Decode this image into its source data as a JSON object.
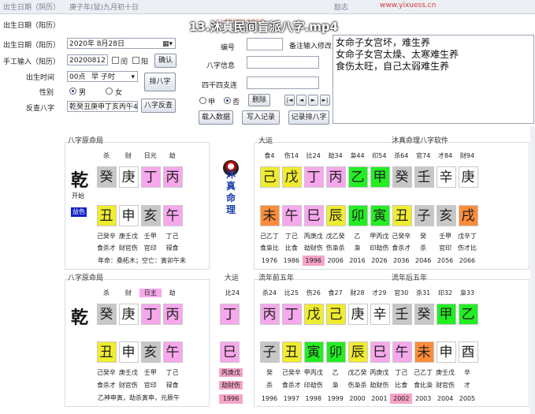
{
  "video_title": "13.沐真民间盲派八字.mp4",
  "topbar": {
    "left_blurred": "出生日期（阴历）",
    "left_value_blurred": "庚子年(鼠)九月初十日",
    "mid_label": "励志",
    "watermark": "www.yixuess.cn",
    "phone_watermark": "1436044440"
  },
  "form": {
    "solar_label": "出生日期（阳历）",
    "solar_value": "2020年 8月28日",
    "manual_label": "手工输入（阳历）",
    "manual_value": "20200812",
    "leap_label": "闰",
    "yang_label": "阳",
    "confirm_btn": "确认",
    "time_label": "出生时间",
    "time_hour": "00点",
    "time_shichen": "早 子时",
    "paipan_btn": "排八字",
    "gender_label": "性别",
    "male": "男",
    "female": "女",
    "reverse_label": "反查八字",
    "reverse_value": "乾癸丑庚申丁亥丙午4",
    "reverse_btn": "八字反查",
    "bianhao_label": "编号",
    "beizhu_label": "备注输入修改",
    "bazi_info_label": "八字信息",
    "sizhu_label": "四干四支连",
    "jia_label": "甲",
    "fou_label": "否",
    "delete_btn": "删除",
    "nav": [
      "|◄",
      "◄",
      "►",
      "►|"
    ],
    "load_btn": "载入数据",
    "write_btn": "写入记录",
    "record_btn": "记录排八字"
  },
  "notes": [
    "女命子女宫坏，难生养",
    "女命子女宫太燥、太寒难生养",
    "食伤太旺，自己太弱难生养"
  ],
  "brand_text": [
    "沐",
    "真",
    "命",
    "理"
  ],
  "colors": {
    "gray": "#c7c7c7",
    "white": "#ffffff",
    "pink": "#f7a8ec",
    "yellow": "#f0ec2e",
    "green": "#22ee22",
    "orange": "#ff8c3a",
    "blue_badge": "#1022c8",
    "highlight_pink": "#f5a4c8"
  },
  "top": {
    "section_label": "八字原命局",
    "qian": "乾",
    "kaiyun": "开始",
    "badge": "益色",
    "gods": [
      "杀",
      "财",
      "日元",
      "劫"
    ],
    "stems": [
      "癸",
      "庚",
      "丁",
      "丙"
    ],
    "stem_colors": [
      "gray",
      "white",
      "pink",
      "pink"
    ],
    "branches": [
      "丑",
      "申",
      "亥",
      "午"
    ],
    "branch_colors": [
      "yellow",
      "white",
      "gray",
      "pink"
    ],
    "hidden": [
      "己癸辛",
      "庚壬戊",
      "壬甲",
      "丁己"
    ],
    "hidden_gods": [
      "食杀才",
      "财官伤",
      "官印",
      "禄食"
    ],
    "footer": "年命：桑柘木；空亡：寅卯午未",
    "dayun_label": "大运",
    "dayun_gods": [
      "食4",
      "伤14",
      "比24",
      "劫34",
      "枭44",
      "印54",
      "杀64",
      "官74",
      "才84",
      "财94"
    ],
    "dayun_stems": [
      "己",
      "戊",
      "丁",
      "丙",
      "乙",
      "甲",
      "癸",
      "壬",
      "辛",
      "庚"
    ],
    "dayun_stem_colors": [
      "yellow",
      "yellow",
      "pink",
      "pink",
      "green",
      "green",
      "gray",
      "gray",
      "white",
      "white"
    ],
    "dayun_branches": [
      "未",
      "午",
      "巳",
      "辰",
      "卯",
      "寅",
      "丑",
      "子",
      "亥",
      "戌"
    ],
    "dayun_branch_colors": [
      "orange",
      "pink",
      "pink",
      "yellow",
      "green",
      "green",
      "yellow",
      "gray",
      "gray",
      "orange"
    ],
    "dayun_hidden": [
      "己乙丁",
      "丁己",
      "丙庚戊",
      "戊乙癸",
      "乙",
      "甲丙戊",
      "己癸辛",
      "癸",
      "壬甲",
      "戊辛丁"
    ],
    "dayun_hidden_gods": [
      "食枭比",
      "比食",
      "劫财伤",
      "伤枭杀",
      "枭",
      "印劫伤",
      "食杀才",
      "杀",
      "官印",
      "伤才比"
    ],
    "dayun_years": [
      "1976",
      "1986",
      "1996",
      "2006",
      "2016",
      "2026",
      "2036",
      "2046",
      "2056",
      "2066"
    ],
    "software_label": "沐真命理八字软件"
  },
  "bottom": {
    "section_label": "八字原命局",
    "qian": "乾",
    "gods": [
      "杀",
      "财",
      "日主",
      "劫"
    ],
    "stems": [
      "癸",
      "庚",
      "丁",
      "丙"
    ],
    "stem_colors": [
      "gray",
      "white",
      "pink",
      "pink"
    ],
    "branches": [
      "丑",
      "申",
      "亥",
      "午"
    ],
    "branch_colors": [
      "yellow",
      "white",
      "gray",
      "pink"
    ],
    "hidden": [
      "己癸辛",
      "庚壬戊",
      "壬甲",
      "丁己"
    ],
    "hidden_gods": [
      "食杀才",
      "财官伤",
      "官印",
      "禄食"
    ],
    "footer": "乙神申寅，劫杀寅申，元辰午",
    "dy_label": "大运",
    "dy_god": "比24",
    "dy_stem": "丁",
    "dy_branch": "巳",
    "dy_hidden": "丙庚戊",
    "dy_hidden_god": "劫财伤",
    "dy_year": "1996",
    "prev_label": "流年前五年",
    "next_label": "流年后五年",
    "ln_gods": [
      "杀24",
      "比25",
      "伤26",
      "食27",
      "财28",
      "才29",
      "官30",
      "杀31",
      "印32",
      "枭33"
    ],
    "ln_stems": [
      "丙",
      "丁",
      "戊",
      "己",
      "庚",
      "辛",
      "壬",
      "癸",
      "甲",
      "乙"
    ],
    "ln_stem_colors": [
      "pink",
      "pink",
      "yellow",
      "yellow",
      "white",
      "white",
      "gray",
      "gray",
      "green",
      "green"
    ],
    "ln_branches": [
      "子",
      "丑",
      "寅",
      "卯",
      "辰",
      "巳",
      "午",
      "未",
      "申",
      "酉"
    ],
    "ln_branch_colors": [
      "gray",
      "yellow",
      "green",
      "green",
      "yellow",
      "pink",
      "pink",
      "orange",
      "white",
      "white"
    ],
    "ln_hidden": [
      "癸",
      "己癸辛",
      "甲丙戊",
      "乙",
      "戊乙癸",
      "丙庚戊",
      "丁己",
      "己乙丁",
      "庚壬戊",
      "辛"
    ],
    "ln_hidden_gods": [
      "杀",
      "食杀才",
      "印劫伤",
      "枭",
      "伤枭杀",
      "劫财伤",
      "比食",
      "食比枭",
      "财官伤",
      "才"
    ],
    "ln_years": [
      "1996",
      "1997",
      "1998",
      "1999",
      "2000",
      "2001",
      "2002",
      "2003",
      "2004",
      "2005"
    ]
  }
}
